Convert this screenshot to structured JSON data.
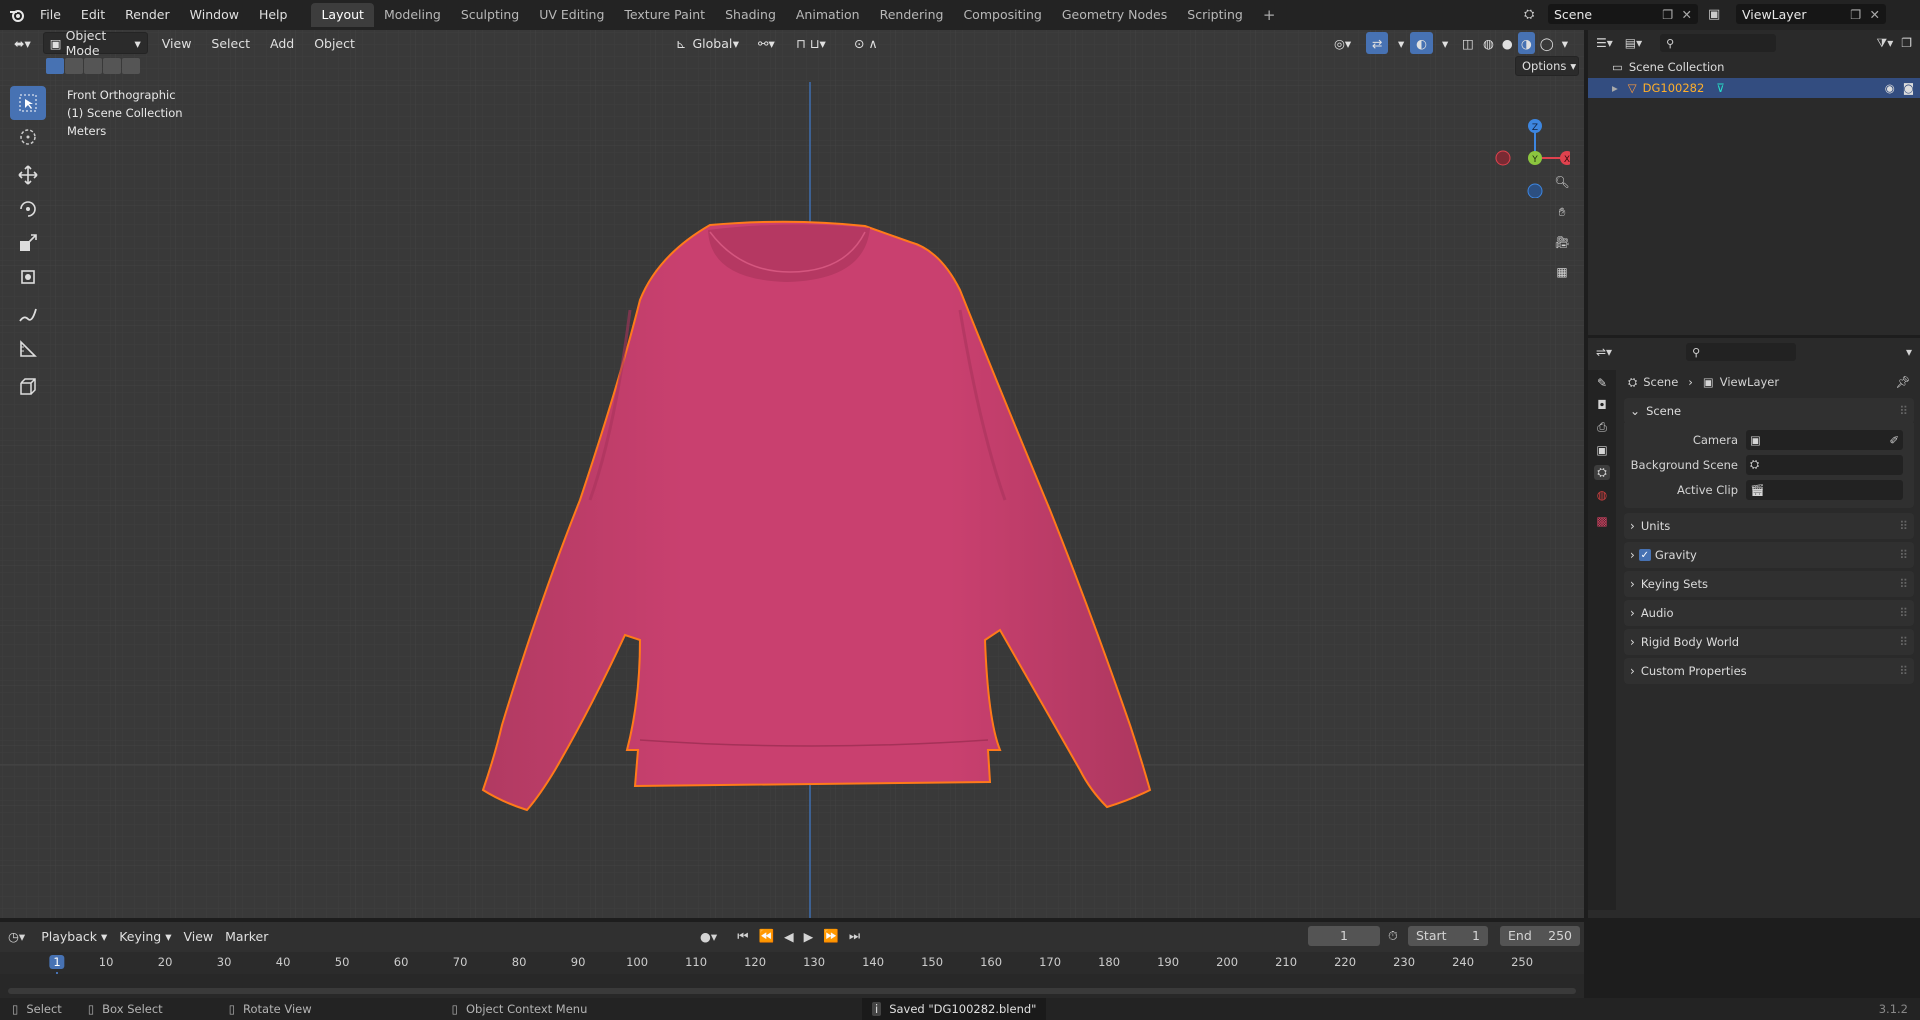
{
  "topbar": {
    "menus": [
      "File",
      "Edit",
      "Render",
      "Window",
      "Help"
    ],
    "workspaces": [
      "Layout",
      "Modeling",
      "Sculpting",
      "UV Editing",
      "Texture Paint",
      "Shading",
      "Animation",
      "Rendering",
      "Compositing",
      "Geometry Nodes",
      "Scripting"
    ],
    "active_workspace": "Layout",
    "scene": "Scene",
    "view_layer": "ViewLayer"
  },
  "viewport": {
    "mode": "Object Mode",
    "menus": [
      "View",
      "Select",
      "Add",
      "Object"
    ],
    "orientation": "Global",
    "options_label": "Options",
    "overlay_lines": [
      "Front Orthographic",
      "(1) Scene Collection",
      "Meters"
    ],
    "gizmo_axes": {
      "z": "Z",
      "y": "Y",
      "x": "X"
    },
    "colors": {
      "x": "#e0424e",
      "y": "#8cc63f",
      "z": "#3d86e0",
      "object": "#c9406f",
      "selection": "#ff7a1a"
    }
  },
  "outliner": {
    "root": "Scene Collection",
    "object": "DG100282"
  },
  "properties": {
    "breadcrumb": [
      "Scene",
      "ViewLayer"
    ],
    "panel_title": "Scene",
    "fields": [
      {
        "label": "Camera",
        "value": ""
      },
      {
        "label": "Background Scene",
        "value": ""
      },
      {
        "label": "Active Clip",
        "value": ""
      }
    ],
    "sections": [
      "Units",
      "Gravity",
      "Keying Sets",
      "Audio",
      "Rigid Body World",
      "Custom Properties"
    ],
    "gravity_checked": true
  },
  "timeline": {
    "menus": [
      "Playback",
      "Keying",
      "View",
      "Marker"
    ],
    "current_frame": "1",
    "start_label": "Start",
    "start": "1",
    "end_label": "End",
    "end": "250",
    "ruler": [
      "1",
      "10",
      "20",
      "30",
      "40",
      "50",
      "60",
      "70",
      "80",
      "90",
      "100",
      "110",
      "120",
      "130",
      "140",
      "150",
      "160",
      "170",
      "180",
      "190",
      "200",
      "210",
      "220",
      "230",
      "240",
      "250"
    ]
  },
  "statusbar": {
    "select": "Select",
    "box_select": "Box Select",
    "rotate": "Rotate View",
    "context": "Object Context Menu",
    "message": "Saved \"DG100282.blend\"",
    "version": "3.1.2"
  }
}
